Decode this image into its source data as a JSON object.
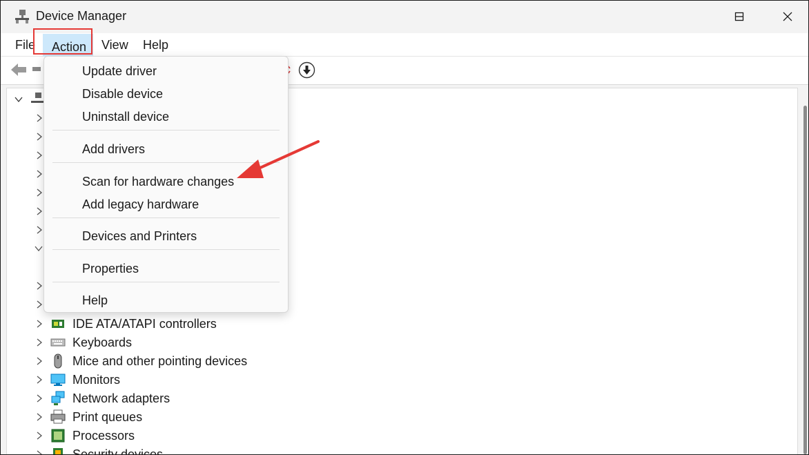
{
  "window": {
    "title": "Device Manager"
  },
  "menubar": {
    "file": "File",
    "action": "Action",
    "view": "View",
    "help": "Help"
  },
  "action_menu": {
    "items": [
      "Update driver",
      "Disable device",
      "Uninstall device",
      "Add drivers",
      "Scan for hardware changes",
      "Add legacy hardware",
      "Devices and Printers",
      "Properties",
      "Help"
    ]
  },
  "tree": {
    "visible_categories": [
      "IDE ATA/ATAPI controllers",
      "Keyboards",
      "Mice and other pointing devices",
      "Monitors",
      "Network adapters",
      "Print queues",
      "Processors",
      "Security devices"
    ]
  },
  "annotation": {
    "color": "#e53935"
  },
  "colors": {
    "menu_hover": "#cde8fb",
    "highlight_box": "#e53935"
  }
}
